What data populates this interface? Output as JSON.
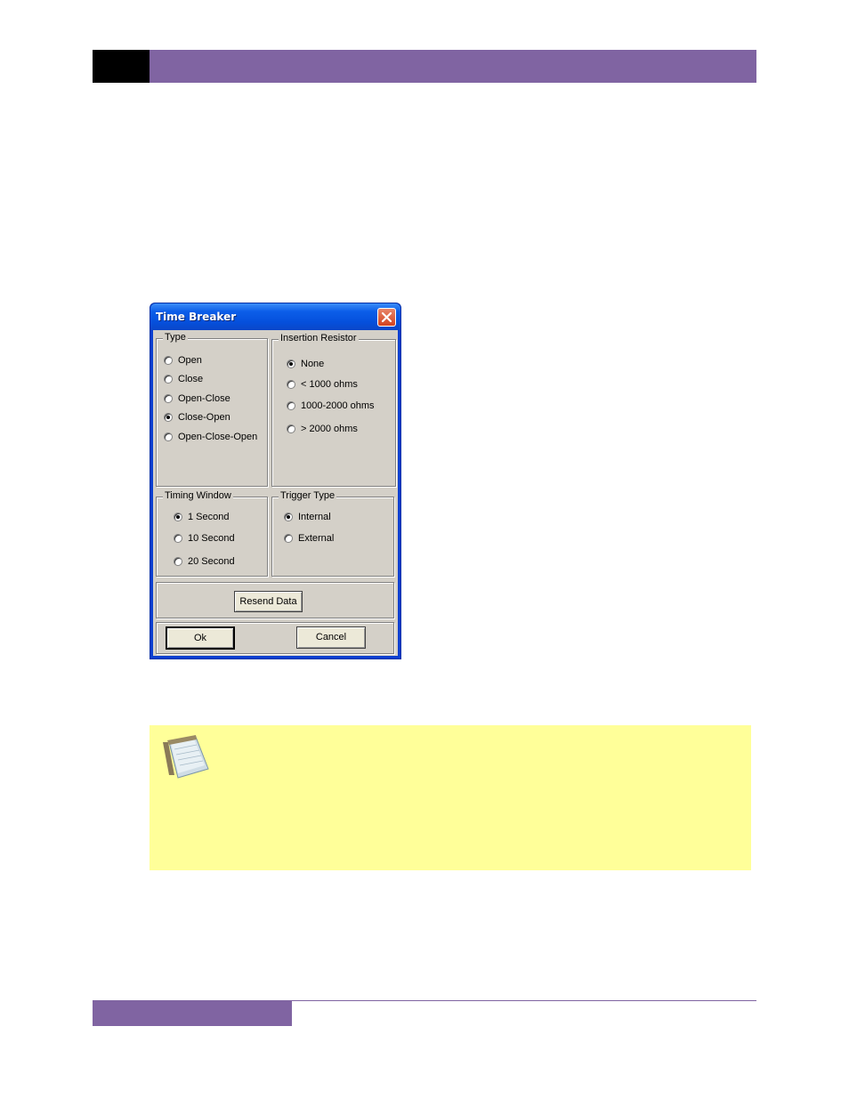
{
  "dialog": {
    "title": "Time Breaker",
    "close_icon": "close-icon",
    "type_group": {
      "legend": "Type",
      "options": [
        {
          "label": "Open",
          "selected": false
        },
        {
          "label": "Close",
          "selected": false
        },
        {
          "label": "Open-Close",
          "selected": false
        },
        {
          "label": "Close-Open",
          "selected": true
        },
        {
          "label": "Open-Close-Open",
          "selected": false
        }
      ]
    },
    "insertion_group": {
      "legend": "Insertion Resistor",
      "options": [
        {
          "label": "None",
          "selected": true
        },
        {
          "label": "< 1000 ohms",
          "selected": false
        },
        {
          "label": "1000-2000 ohms",
          "selected": false
        },
        {
          "label": "> 2000 ohms",
          "selected": false
        }
      ]
    },
    "timing_group": {
      "legend": "Timing Window",
      "options": [
        {
          "label": "1 Second",
          "selected": true
        },
        {
          "label": "10 Second",
          "selected": false
        },
        {
          "label": "20 Second",
          "selected": false
        }
      ]
    },
    "trigger_group": {
      "legend": "Trigger Type",
      "options": [
        {
          "label": "Internal",
          "selected": true
        },
        {
          "label": "External",
          "selected": false
        }
      ]
    },
    "resend_label": "Resend Data",
    "ok_label": "Ok",
    "cancel_label": "Cancel"
  },
  "note": {
    "icon": "notepad-icon"
  },
  "colors": {
    "accent_purple": "#8064a2",
    "note_yellow": "#ffff99"
  }
}
